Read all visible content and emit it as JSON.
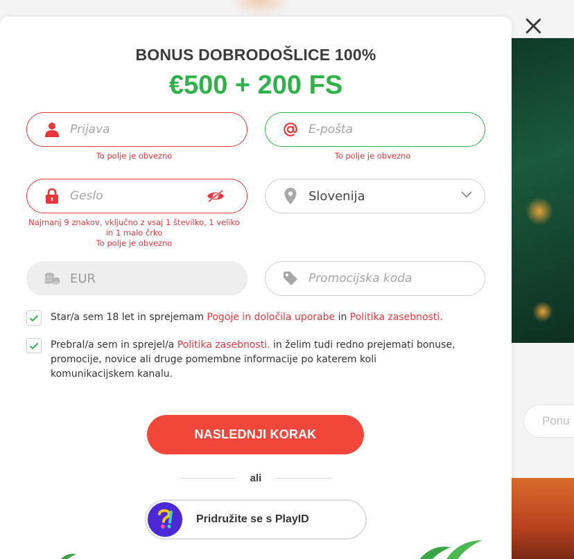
{
  "modal": {
    "title": "BONUS DOBRODOŠLICE 100%",
    "subtitle": "€500 + 200 FS"
  },
  "form": {
    "login": {
      "placeholder": "Prijava",
      "error": "To polje je obvezno"
    },
    "email": {
      "placeholder": "E-pošta",
      "error": "To polje je obvezno"
    },
    "password": {
      "placeholder": "Geslo",
      "hint": "Najmanj 9 znakov, vključno z vsaj 1 številko, 1 veliko in 1 malo črko",
      "error": "To polje je obvezno"
    },
    "country": {
      "value": "Slovenija"
    },
    "currency": {
      "value": "EUR"
    },
    "promo": {
      "placeholder": "Promocijska koda"
    }
  },
  "consents": [
    {
      "checked": true,
      "prefix": "Star/a sem 18 let in sprejemam ",
      "link1": "Pogoje in določila uporabe",
      "middle": " in ",
      "link2": "Politika zasebnosti."
    },
    {
      "checked": true,
      "prefix": "Prebral/a sem in sprejel/a ",
      "link1": "Politika zasebnosti.",
      "suffix": " in želim tudi redno prejemati bonuse, promocije, novice ali druge pomembne informacije po katerem koli komunikacijskem kanalu."
    }
  ],
  "actions": {
    "next_step": "NASLEDNJI KORAK",
    "or": "ali",
    "playid": "Pridružite se s PlayID"
  },
  "background": {
    "search_placeholder": "Ponu"
  },
  "colors": {
    "accent_red": "#f1473b",
    "error_red": "#e8363a",
    "success_green": "#2fb24a",
    "playid_purple": "#4b2ad6"
  },
  "icons": {
    "login": "user-icon",
    "email": "at-icon",
    "password": "lock-icon",
    "password_toggle": "eye-slash-icon",
    "country": "location-pin-icon",
    "currency": "coins-icon",
    "promo": "tag-icon",
    "close": "close-icon"
  }
}
